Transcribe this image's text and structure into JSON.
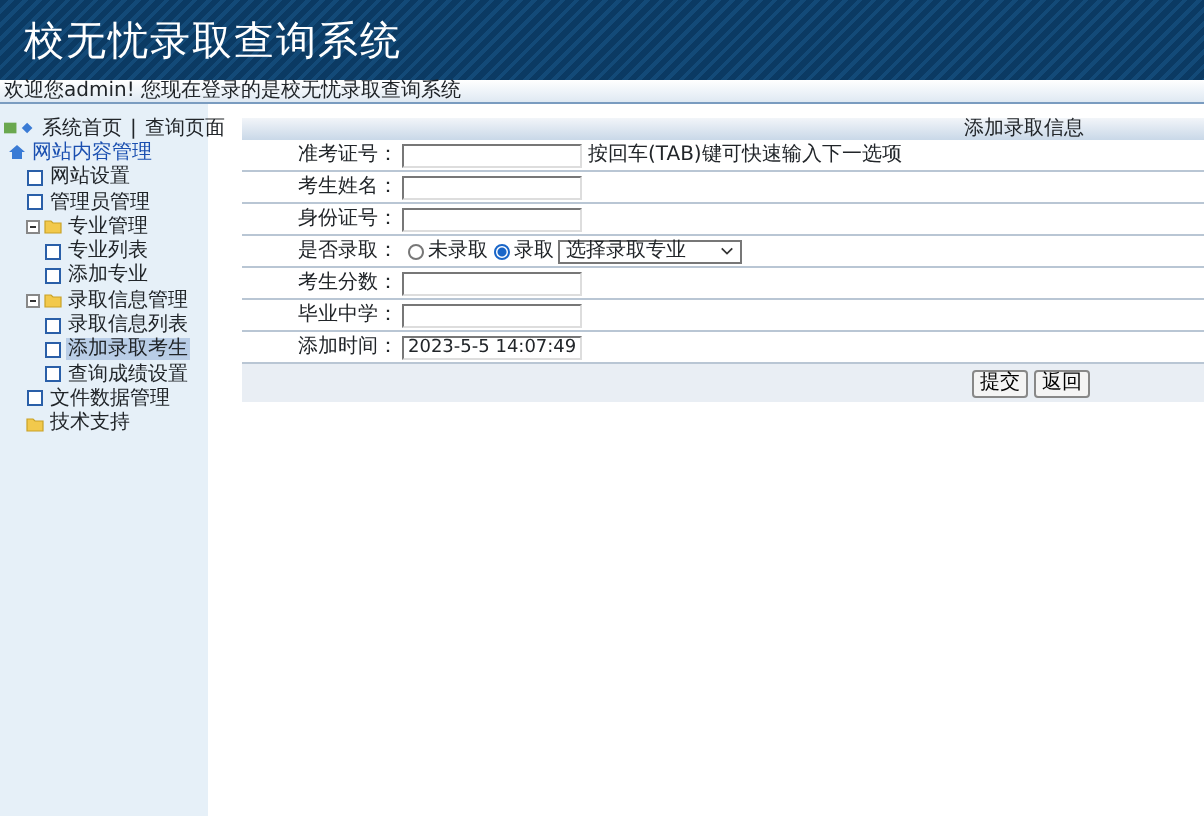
{
  "header": {
    "title": "校无忧录取查询系统"
  },
  "welcome_bar": {
    "text": "欢迎您admin! 您现在登录的是校无忧录取查询系统"
  },
  "sidebar": {
    "links": [
      "系统首页",
      "查询页面"
    ],
    "separator": "|",
    "tree": [
      {
        "label": "网站内容管理",
        "kind": "home",
        "children": [
          {
            "label": "网站设置",
            "kind": "page",
            "selected": false
          },
          {
            "label": "管理员管理",
            "kind": "page",
            "selected": false
          },
          {
            "label": "专业管理",
            "kind": "folder",
            "expanded": true,
            "children": [
              {
                "label": "专业列表",
                "kind": "page",
                "selected": false
              },
              {
                "label": "添加专业",
                "kind": "page",
                "selected": false
              }
            ]
          },
          {
            "label": "录取信息管理",
            "kind": "folder",
            "expanded": true,
            "children": [
              {
                "label": "录取信息列表",
                "kind": "page",
                "selected": false
              },
              {
                "label": "添加录取考生",
                "kind": "page",
                "selected": true
              },
              {
                "label": "查询成绩设置",
                "kind": "page",
                "selected": false
              }
            ]
          },
          {
            "label": "文件数据管理",
            "kind": "page",
            "selected": false
          },
          {
            "label": "技术支持",
            "kind": "folder"
          }
        ]
      }
    ]
  },
  "form": {
    "title": "添加录取信息",
    "rows": [
      {
        "kind": "text",
        "label": "准考证号：",
        "hint": "按回车(TAB)键可快速输入下一选项"
      },
      {
        "kind": "text",
        "label": "考生姓名："
      },
      {
        "kind": "text",
        "label": "身份证号："
      },
      {
        "kind": "radio",
        "label": "是否录取：",
        "options": [
          {
            "label": "未录取",
            "selected": false
          },
          {
            "label": "录取",
            "selected": true
          }
        ],
        "select": {
          "value": "选择录取专业"
        }
      },
      {
        "kind": "text",
        "label": "考生分数："
      },
      {
        "kind": "text",
        "label": "毕业中学："
      },
      {
        "kind": "text",
        "label": "添加时间：",
        "value": "2023-5-5 14:07:49"
      }
    ],
    "buttons": [
      "提交",
      "返回"
    ]
  }
}
